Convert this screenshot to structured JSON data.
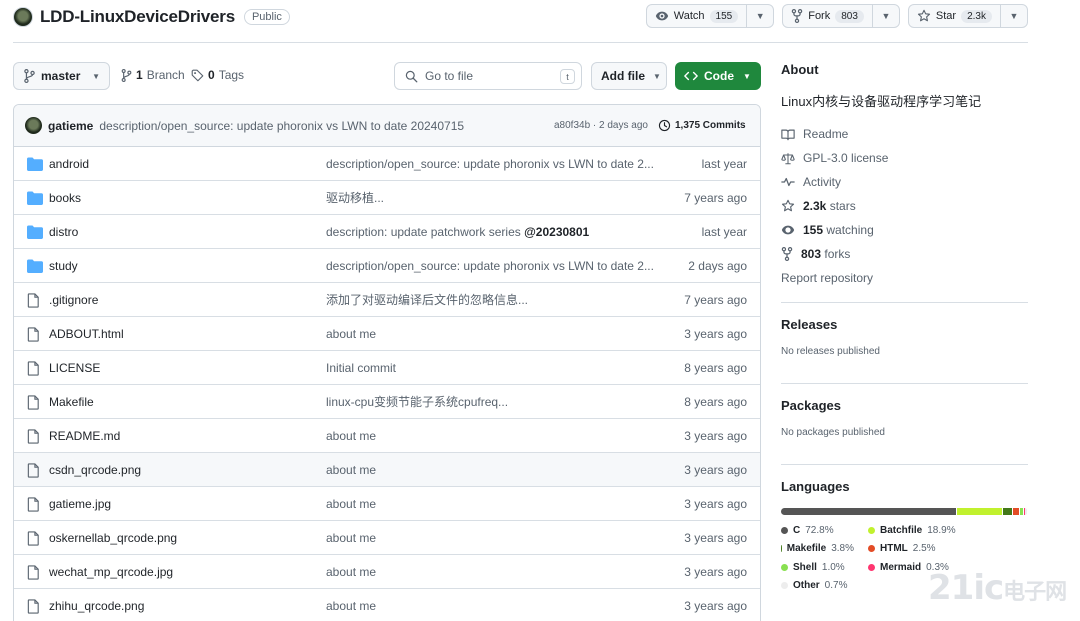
{
  "repo": {
    "name": "LDD-LinuxDeviceDrivers",
    "visibility": "Public",
    "watch_label": "Watch",
    "watch_count": "155",
    "fork_label": "Fork",
    "fork_count": "803",
    "star_label": "Star",
    "star_count": "2.3k"
  },
  "toolbar": {
    "branch": "master",
    "branches_count": "1",
    "branches_label": "Branch",
    "tags_count": "0",
    "tags_label": "Tags",
    "goto_placeholder": "Go to file",
    "goto_shortcut": "t",
    "add_file_label": "Add file",
    "code_label": "Code"
  },
  "commit": {
    "author": "gatieme",
    "message": "description/open_source: update phoronix vs LWN to date 20240715",
    "hash_time": "a80f34b · 2 days ago",
    "count": "1,375 Commits"
  },
  "files": [
    {
      "name": "android",
      "type": "dir",
      "message": "description/open_source: update phoronix vs LWN to date 2...",
      "date": "last year"
    },
    {
      "name": "books",
      "type": "dir",
      "message": "驱动移植...",
      "date": "7 years ago"
    },
    {
      "name": "distro",
      "type": "dir",
      "message": "description: update patchwork series ",
      "message_bold": "@20230801",
      "date": "last year"
    },
    {
      "name": "study",
      "type": "dir",
      "message": "description/open_source: update phoronix vs LWN to date 2...",
      "date": "2 days ago"
    },
    {
      "name": ".gitignore",
      "type": "file",
      "message": "添加了对驱动编译后文件的忽略信息...",
      "date": "7 years ago"
    },
    {
      "name": "ADBOUT.html",
      "type": "file",
      "message": "about me",
      "date": "3 years ago"
    },
    {
      "name": "LICENSE",
      "type": "file",
      "message": "Initial commit",
      "date": "8 years ago"
    },
    {
      "name": "Makefile",
      "type": "file",
      "message": "linux-cpu变频节能子系统cpufreq...",
      "date": "8 years ago"
    },
    {
      "name": "README.md",
      "type": "file",
      "message": "about me",
      "date": "3 years ago"
    },
    {
      "name": "csdn_qrcode.png",
      "type": "file",
      "message": "about me",
      "date": "3 years ago"
    },
    {
      "name": "gatieme.jpg",
      "type": "file",
      "message": "about me",
      "date": "3 years ago"
    },
    {
      "name": "oskernellab_qrcode.png",
      "type": "file",
      "message": "about me",
      "date": "3 years ago"
    },
    {
      "name": "wechat_mp_qrcode.jpg",
      "type": "file",
      "message": "about me",
      "date": "3 years ago"
    },
    {
      "name": "zhihu_qrcode.png",
      "type": "file",
      "message": "about me",
      "date": "3 years ago"
    }
  ],
  "about": {
    "heading": "About",
    "description": "Linux内核与设备驱动程序学习笔记",
    "readme": "Readme",
    "license": "GPL-3.0 license",
    "activity": "Activity",
    "stars_count": "2.3k",
    "stars_label": "stars",
    "watching_count": "155",
    "watching_label": "watching",
    "forks_count": "803",
    "forks_label": "forks",
    "report": "Report repository"
  },
  "releases": {
    "heading": "Releases",
    "empty": "No releases published"
  },
  "packages": {
    "heading": "Packages",
    "empty": "No packages published"
  },
  "languages": {
    "heading": "Languages",
    "items": [
      {
        "name": "C",
        "percent": "72.8%",
        "value": 72.8,
        "color": "#555555"
      },
      {
        "name": "Batchfile",
        "percent": "18.9%",
        "value": 18.9,
        "color": "#C1F12E"
      },
      {
        "name": "Makefile",
        "percent": "3.8%",
        "value": 3.8,
        "color": "#427819"
      },
      {
        "name": "HTML",
        "percent": "2.5%",
        "value": 2.5,
        "color": "#E34C26"
      },
      {
        "name": "Shell",
        "percent": "1.0%",
        "value": 1.0,
        "color": "#89E051"
      },
      {
        "name": "Mermaid",
        "percent": "0.3%",
        "value": 0.3,
        "color": "#FF3670"
      },
      {
        "name": "Other",
        "percent": "0.7%",
        "value": 0.7,
        "color": "#EDEDED"
      }
    ]
  },
  "watermark": {
    "big": "21ic",
    "small": "电子网"
  }
}
